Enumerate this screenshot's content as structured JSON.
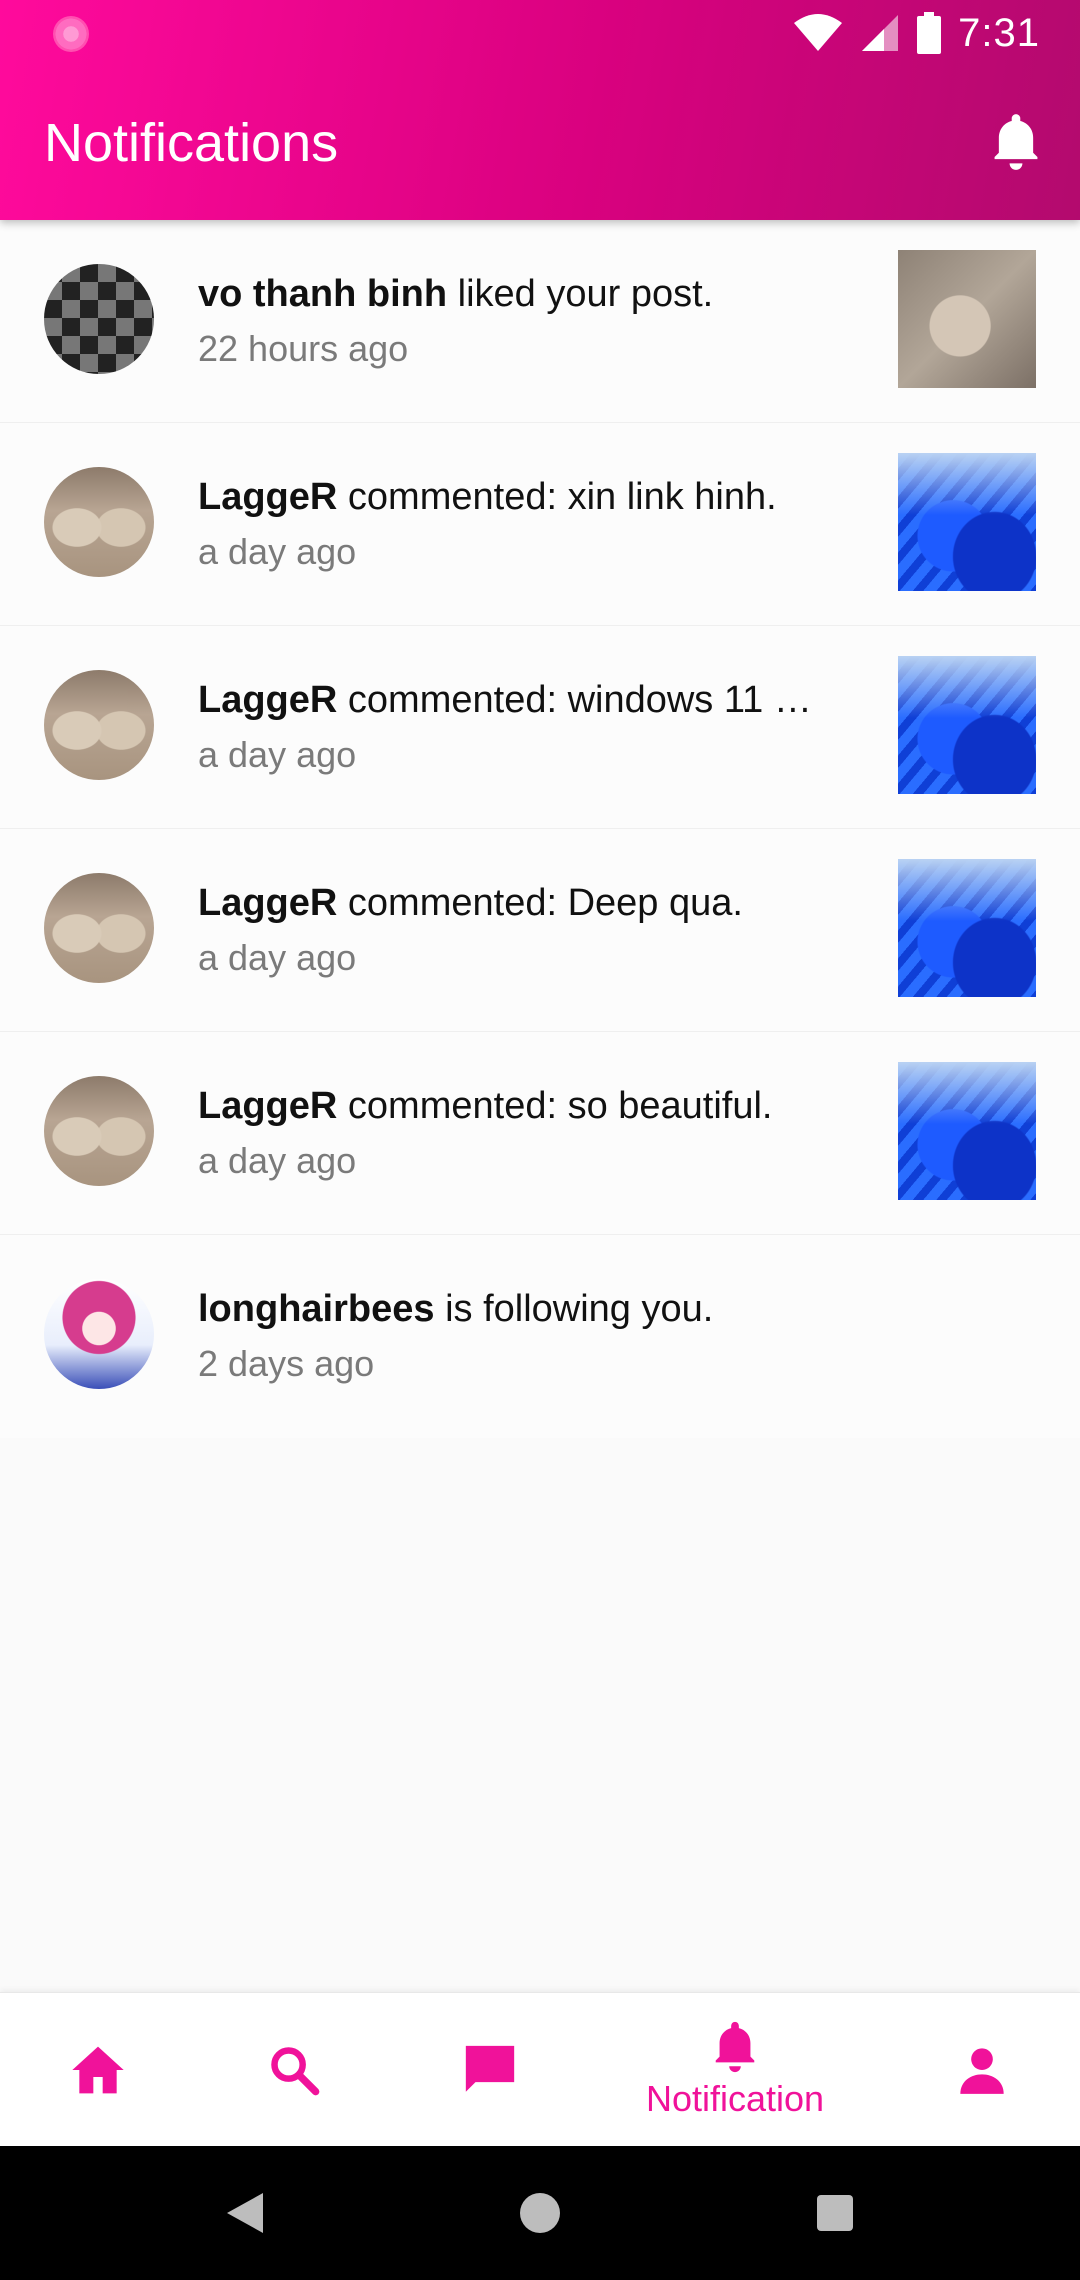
{
  "status_bar": {
    "time": "7:31"
  },
  "app_bar": {
    "title": "Notifications"
  },
  "notifications": [
    {
      "user": "vo thanh binh",
      "action": "liked your post.",
      "time": "22 hours ago",
      "avatar": "checkerboard-avatar",
      "thumbnail": "chair-photo"
    },
    {
      "user": "LaggeR",
      "action": "commented: xin link hinh.",
      "time": "a day ago",
      "avatar": "pillow-avatar",
      "thumbnail": "windows-wallpaper"
    },
    {
      "user": "LaggeR",
      "action": "commented: windows 11 …",
      "time": "a day ago",
      "avatar": "pillow-avatar",
      "thumbnail": "windows-wallpaper"
    },
    {
      "user": "LaggeR",
      "action": "commented: Deep qua.",
      "time": "a day ago",
      "avatar": "pillow-avatar",
      "thumbnail": "windows-wallpaper"
    },
    {
      "user": "LaggeR",
      "action": "commented: so beautiful.",
      "time": "a day ago",
      "avatar": "pillow-avatar",
      "thumbnail": "windows-wallpaper"
    },
    {
      "user": "longhairbees",
      "action": "is following you.",
      "time": "2 days ago",
      "avatar": "anime-avatar",
      "thumbnail": null
    }
  ],
  "bottom_nav": {
    "items": [
      {
        "icon": "home-icon",
        "label": ""
      },
      {
        "icon": "search-icon",
        "label": ""
      },
      {
        "icon": "chat-icon",
        "label": ""
      },
      {
        "icon": "bell-icon",
        "label": "Notification",
        "active": true
      },
      {
        "icon": "person-icon",
        "label": ""
      }
    ]
  },
  "colors": {
    "accent": "#f0129a",
    "header_start": "#ff0a9c",
    "header_end": "#b30a6e"
  }
}
